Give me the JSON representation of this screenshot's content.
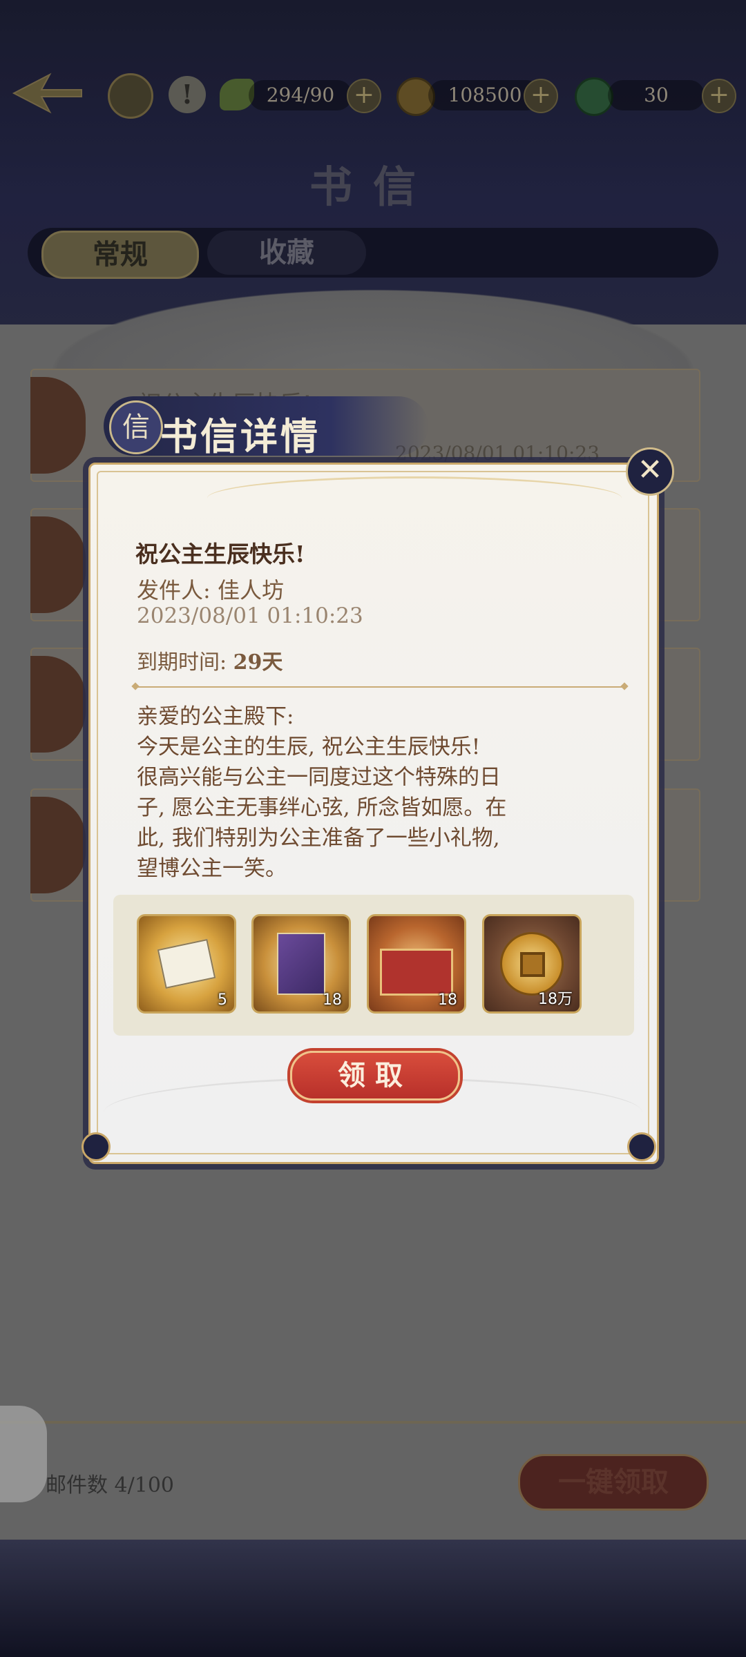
{
  "topbar": {
    "stamina": "294/90",
    "coins": "108500",
    "jade": "30",
    "plus_label": "+"
  },
  "page_title": "书信",
  "tabs": [
    {
      "label": "常规",
      "active": true
    },
    {
      "label": "收藏",
      "active": false
    }
  ],
  "background_mail": {
    "title": "祝公主生辰快乐!",
    "date": "2023/08/01 01:10:23"
  },
  "footer": {
    "mail_count": "邮件数 4/100",
    "claim_all": "一键领取"
  },
  "dialog": {
    "header": "书信详情",
    "header_icon_glyph": "信",
    "close_glyph": "✕",
    "title": "祝公主生辰快乐!",
    "sender": "发件人: 佳人坊",
    "date": "2023/08/01 01:10:23",
    "expire_label": "到期时间: ",
    "expire_value": "29天",
    "body_lines": [
      "亲爱的公主殿下:",
      "今天是公主的生辰, 祝公主生辰快乐!",
      "很高兴能与公主一同度过这个特殊的日",
      "子, 愿公主无事绊心弦, 所念皆如愿。在",
      "此, 我们特别为公主准备了一些小礼物,",
      "望博公主一笑。"
    ],
    "rewards": [
      {
        "icon": "ticket-icon",
        "qty": "5"
      },
      {
        "icon": "book-icon",
        "qty": "18"
      },
      {
        "icon": "chest-icon",
        "qty": "18"
      },
      {
        "icon": "copper-coin-icon",
        "qty": "18万"
      }
    ],
    "claim_label": "领取"
  },
  "colors": {
    "accent_gold": "#c9a768",
    "claim_red": "#c8392f",
    "text_brown": "#6e4a30",
    "header_navy": "#242747"
  }
}
